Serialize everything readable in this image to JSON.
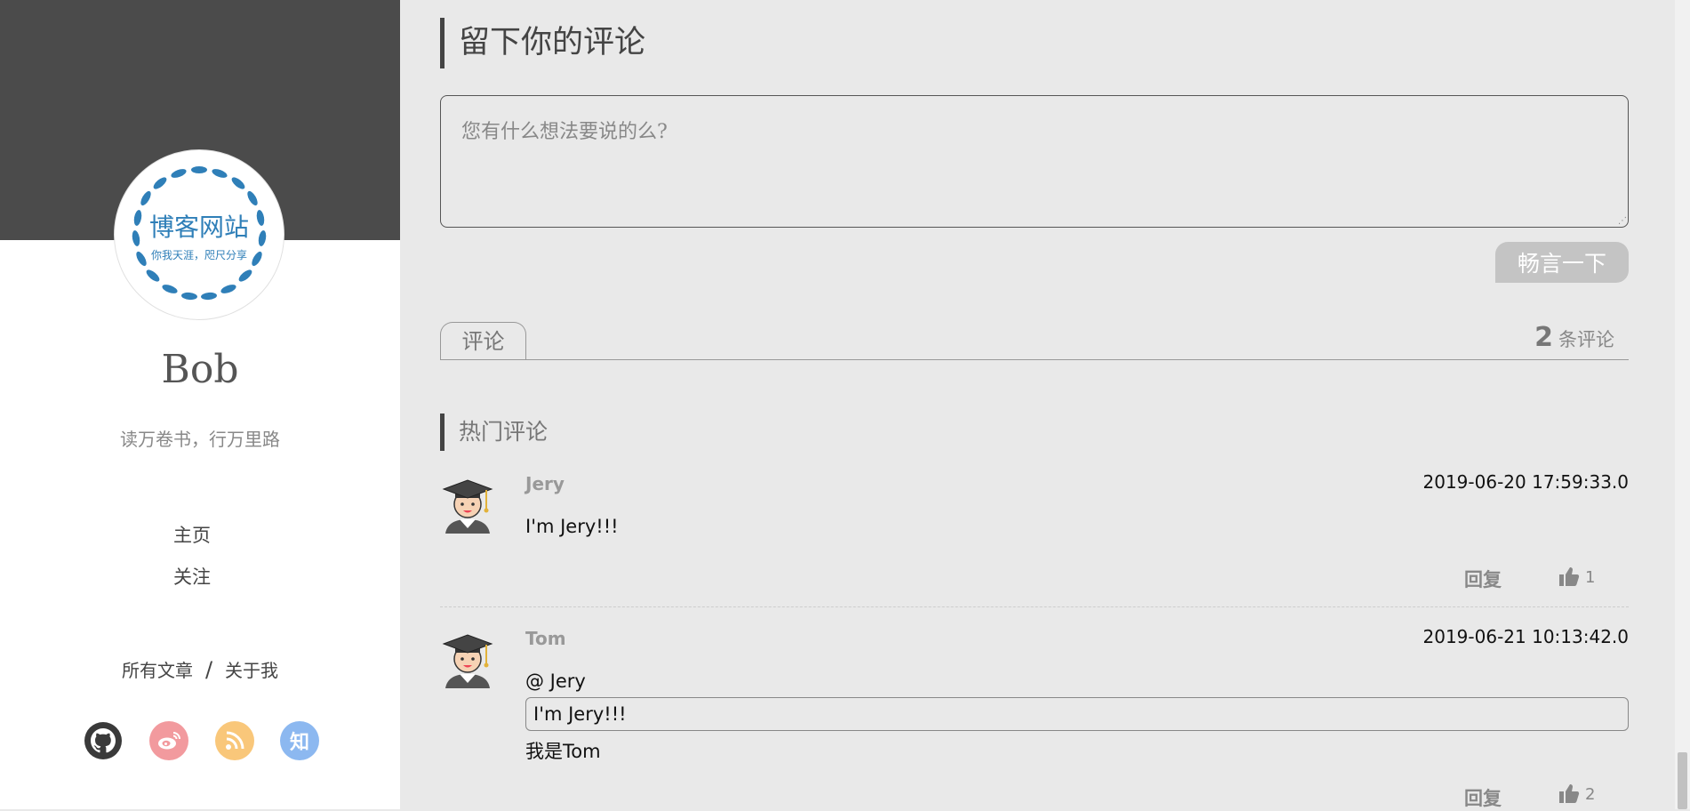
{
  "sidebar": {
    "avatar_logo": {
      "title": "博客网站",
      "slogan": "你我天涯，咫尺分享"
    },
    "author_name": "Bob",
    "motto": "读万卷书，行万里路",
    "nav": [
      {
        "label": "主页"
      },
      {
        "label": "关注"
      }
    ],
    "links": {
      "all_articles": "所有文章",
      "separator": "/",
      "about": "关于我"
    },
    "social": [
      {
        "name": "github-icon",
        "color": "#333333"
      },
      {
        "name": "weibo-icon",
        "color": "#f29a9e"
      },
      {
        "name": "rss-icon",
        "color": "#f9c77a"
      },
      {
        "name": "zhihu-icon",
        "color": "#8cb8f0",
        "glyph": "知"
      }
    ]
  },
  "main": {
    "leave_comment_title": "留下你的评论",
    "comment_input": {
      "placeholder": "您有什么想法要说的么?",
      "value": ""
    },
    "submit_label": "畅言一下",
    "tab_label": "评论",
    "comment_count": {
      "number": "2",
      "unit": "条评论"
    },
    "hot_title": "热门评论",
    "comments": [
      {
        "user": "Jery",
        "time": "2019-06-20 17:59:33.0",
        "text": "I'm Jery!!!",
        "reply_label": "回复",
        "likes": "1"
      },
      {
        "user": "Tom",
        "time": "2019-06-21 10:13:42.0",
        "at": "@ Jery",
        "quote": "I'm Jery!!!",
        "text": "我是Tom",
        "reply_label": "回复",
        "likes": "2"
      }
    ]
  },
  "colors": {
    "sidebar_banner": "#4b4b4b",
    "page_bg": "#e9e9e9",
    "button_bg": "#c4c4c4",
    "accent_bar": "#444444"
  }
}
